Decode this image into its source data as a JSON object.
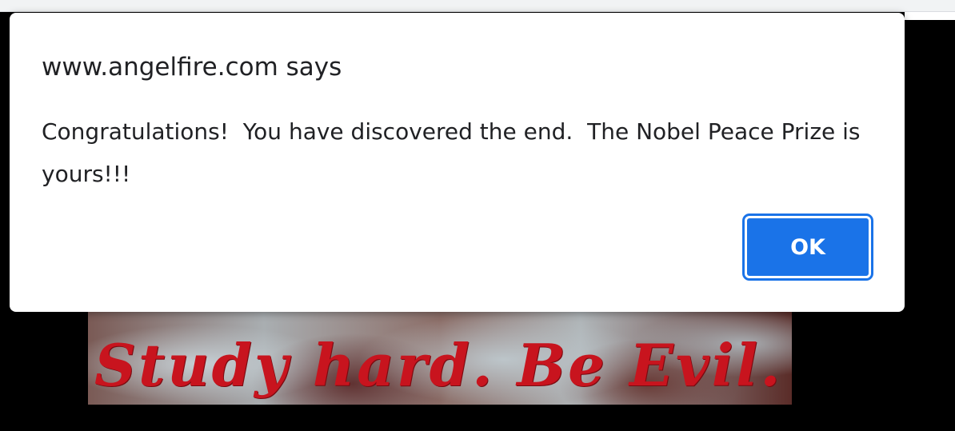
{
  "page": {
    "banner_text": "Study hard. Be Evil."
  },
  "dialog": {
    "title": "www.angelfire.com says",
    "message": "Congratulations!  You have discovered the end.  The Nobel Peace Prize is yours!!!",
    "ok_label": "OK"
  },
  "colors": {
    "accent": "#1a73e8",
    "banner_text": "#c8141e",
    "page_background": "#000000"
  }
}
